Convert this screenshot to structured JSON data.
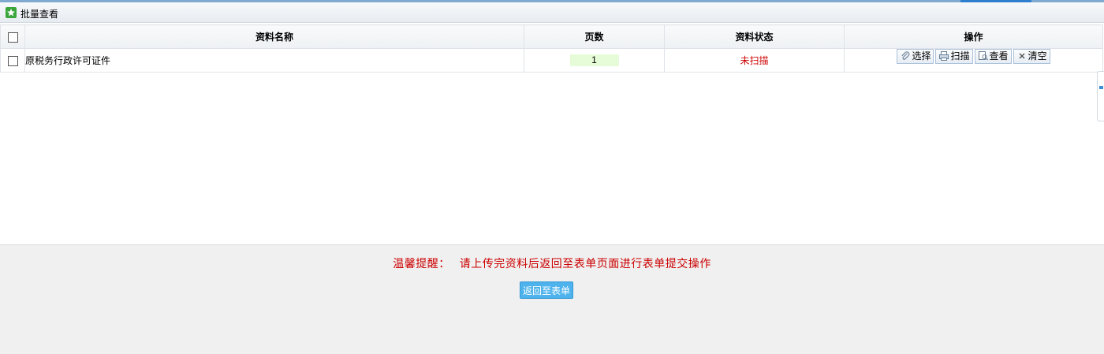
{
  "header": {
    "title": "批量查看",
    "icon": "star-icon"
  },
  "table": {
    "columns": [
      "资料名称",
      "页数",
      "资料状态",
      "操作"
    ],
    "rows": [
      {
        "name": "原税务行政许可证件",
        "pages": "1",
        "status": "未扫描",
        "actions": {
          "select": "选择",
          "scan": "扫描",
          "view": "查看",
          "clear": "清空"
        }
      }
    ]
  },
  "reminder": {
    "label": "温馨提醒：",
    "text": "请上传完资料后返回至表单页面进行表单提交操作"
  },
  "footer": {
    "return_label": "返回至表单"
  },
  "colors": {
    "accent": "#4eb3ec",
    "status_red": "#cc0000",
    "page_bg": "#e6fbd7"
  }
}
